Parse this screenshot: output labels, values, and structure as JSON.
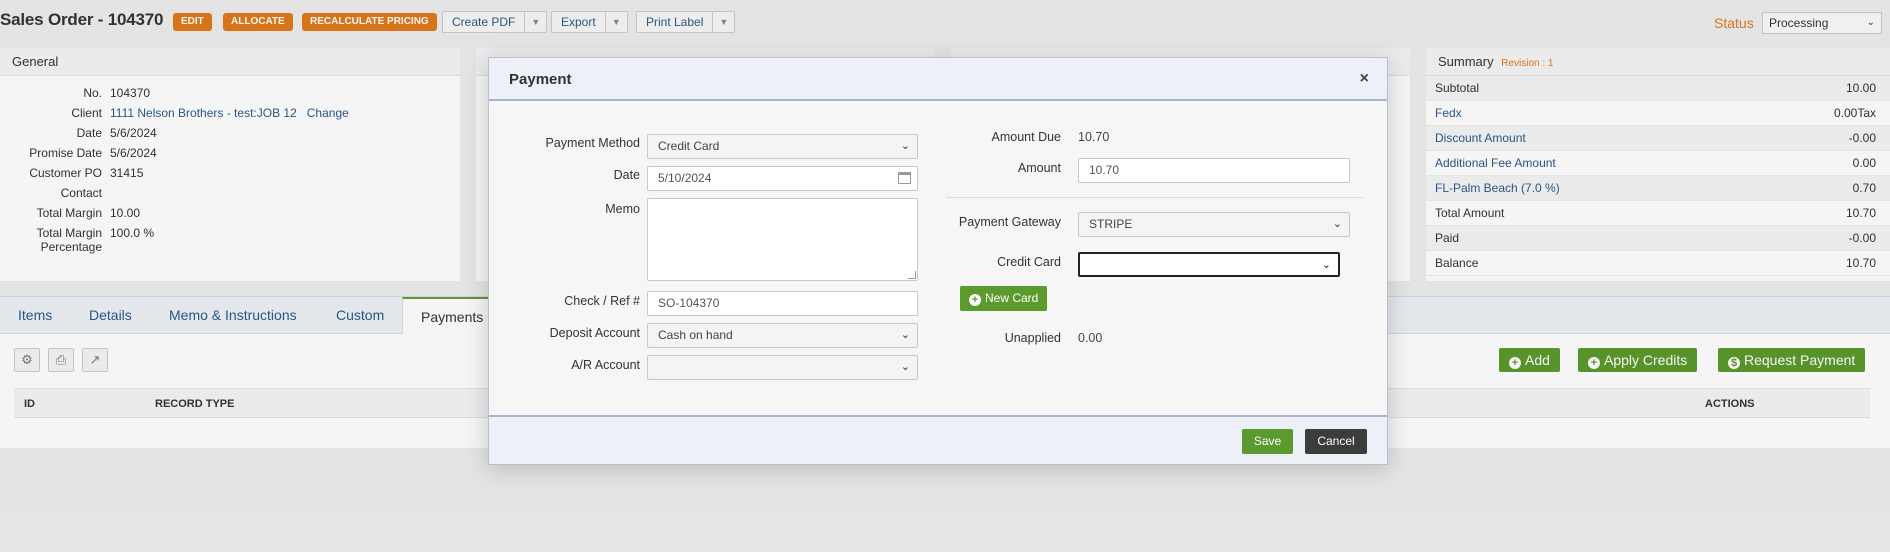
{
  "header": {
    "title": "Sales Order - 104370",
    "edit_label": "EDIT",
    "allocate_label": "ALLOCATE",
    "recalculate_label": "RECALCULATE PRICING",
    "create_pdf_label": "Create PDF",
    "export_label": "Export",
    "print_label_label": "Print Label",
    "status_label": "Status",
    "status_value": "Processing"
  },
  "general": {
    "title": "General",
    "rows": [
      {
        "label": "No.",
        "value": "104370"
      },
      {
        "label": "Client",
        "value": "1111 Nelson Brothers - test:JOB 12",
        "link": "Change"
      },
      {
        "label": "Date",
        "value": "5/6/2024"
      },
      {
        "label": "Promise Date",
        "value": "5/6/2024"
      },
      {
        "label": "Customer PO",
        "value": "31415"
      },
      {
        "label": "Contact",
        "value": ""
      },
      {
        "label": "Total Margin",
        "value": "10.00"
      },
      {
        "label": "Total Margin",
        "label2": "Percentage",
        "value": "100.0 %"
      }
    ]
  },
  "summary": {
    "title": "Summary",
    "revision": "Revision : 1",
    "rows": [
      {
        "label": "Subtotal",
        "value": "10.00"
      },
      {
        "label": "Fedx",
        "value": "0.00Tax"
      },
      {
        "label": "Discount Amount",
        "value": "-0.00"
      },
      {
        "label": "Additional Fee Amount",
        "value": "0.00"
      },
      {
        "label": "FL-Palm Beach (7.0 %)",
        "value": "0.70"
      },
      {
        "label": "Total Amount",
        "value": "10.70"
      },
      {
        "label": "Paid",
        "value": "-0.00"
      },
      {
        "label": "Balance",
        "value": "10.70"
      }
    ]
  },
  "tabs": [
    "Items",
    "Details",
    "Memo & Instructions",
    "Custom",
    "Payments"
  ],
  "payments_tab": {
    "add_label": "Add",
    "apply_credits_label": "Apply Credits",
    "request_payment_label": "Request Payment",
    "columns": [
      "ID",
      "RECORD TYPE",
      "ACTIONS"
    ]
  },
  "modal": {
    "title": "Payment",
    "close": "×",
    "payment_method_label": "Payment Method",
    "payment_method_value": "Credit Card",
    "date_label": "Date",
    "date_value": "5/10/2024",
    "memo_label": "Memo",
    "memo_value": "",
    "check_ref_label": "Check / Ref #",
    "check_ref_value": "SO-104370",
    "deposit_account_label": "Deposit Account",
    "deposit_account_value": "Cash on hand",
    "ar_account_label": "A/R Account",
    "ar_account_value": "",
    "amount_due_label": "Amount Due",
    "amount_due_value": "10.70",
    "amount_label": "Amount",
    "amount_value": "10.70",
    "gateway_label": "Payment Gateway",
    "gateway_value": "STRIPE",
    "credit_card_label": "Credit Card",
    "credit_card_value": "",
    "new_card_label": "New Card",
    "unapplied_label": "Unapplied",
    "unapplied_value": "0.00",
    "save_label": "Save",
    "cancel_label": "Cancel"
  }
}
